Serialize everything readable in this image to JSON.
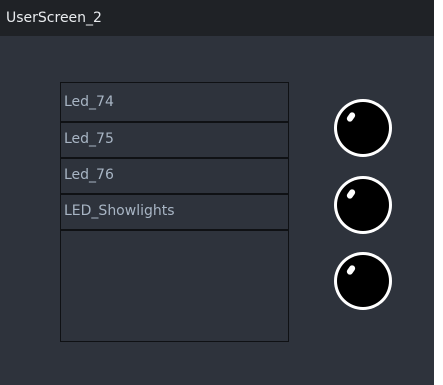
{
  "window": {
    "title": "UserScreen_2"
  },
  "list": {
    "items": [
      {
        "label": "Led_74"
      },
      {
        "label": "Led_75"
      },
      {
        "label": "Led_76"
      },
      {
        "label": "LED_Showlights"
      }
    ]
  },
  "leds": [
    {
      "state": "off",
      "color": "#000000"
    },
    {
      "state": "off",
      "color": "#000000"
    },
    {
      "state": "off",
      "color": "#000000"
    }
  ],
  "colors": {
    "background": "#2e333c",
    "titlebar": "#1f2226",
    "list_text": "#a8b5c4",
    "led_ring": "#ffffff"
  },
  "icons": {
    "led": "led-indicator-icon"
  }
}
